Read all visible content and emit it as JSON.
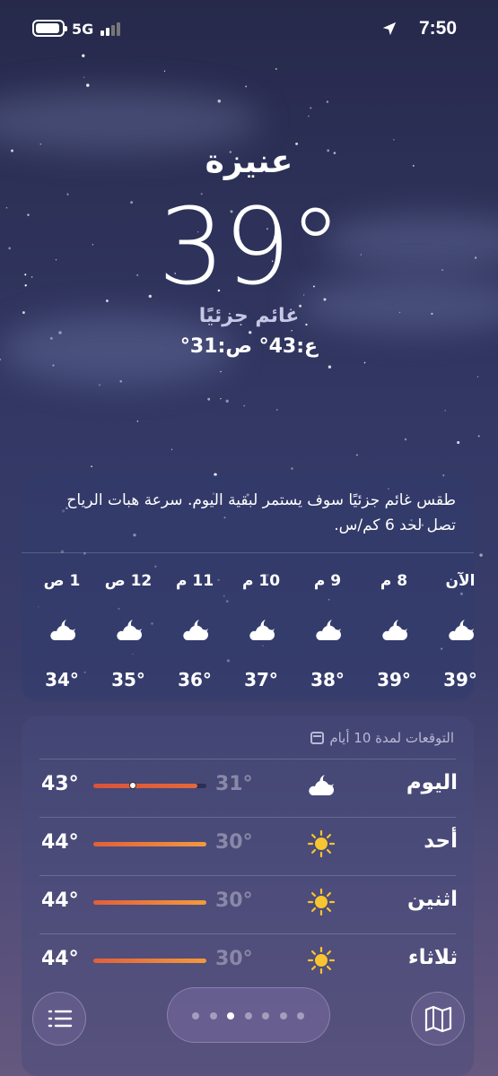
{
  "status_bar": {
    "network": "5G",
    "time": "7:50"
  },
  "location": {
    "city": "عنيزة",
    "temperature": "39°",
    "condition": "غائم جزئيًا",
    "high_low": "ع:43°  ص:31°"
  },
  "hourly": {
    "summary": "طقس غائم جزئيًا سوف يستمر لبقية اليوم. سرعة هبات الرياح تصل لحد 6 كم/س.",
    "hours": [
      {
        "label": "الآن",
        "temp": "39°",
        "icon": "partly-cloudy-night-icon"
      },
      {
        "label": "8 م",
        "temp": "39°",
        "icon": "partly-cloudy-night-icon"
      },
      {
        "label": "9 م",
        "temp": "38°",
        "icon": "partly-cloudy-night-icon"
      },
      {
        "label": "10 م",
        "temp": "37°",
        "icon": "partly-cloudy-night-icon"
      },
      {
        "label": "11 م",
        "temp": "36°",
        "icon": "partly-cloudy-night-icon"
      },
      {
        "label": "12 ص",
        "temp": "35°",
        "icon": "partly-cloudy-night-icon"
      },
      {
        "label": "1 ص",
        "temp": "34°",
        "icon": "partly-cloudy-night-icon"
      }
    ]
  },
  "daily": {
    "header": "التوقعات لمدة 10 أيام",
    "days": [
      {
        "day": "اليوم",
        "low": "31°",
        "high": "43°",
        "icon": "partly-cloudy-night-icon",
        "range_start": 0.0,
        "range_end": 0.92,
        "current": 0.35
      },
      {
        "day": "أحد",
        "low": "30°",
        "high": "44°",
        "icon": "sun-icon",
        "range_start": 0.0,
        "range_end": 1.0
      },
      {
        "day": "اثنين",
        "low": "30°",
        "high": "44°",
        "icon": "sun-icon",
        "range_start": 0.0,
        "range_end": 1.0
      },
      {
        "day": "ثلاثاء",
        "low": "30°",
        "high": "44°",
        "icon": "sun-icon",
        "range_start": 0.0,
        "range_end": 1.0
      }
    ]
  },
  "pager": {
    "count": 7,
    "active_index": 2
  },
  "colors": {
    "bar_warm": "#e0603a",
    "bar_hot": "#f39a3c",
    "sun": "#f7c531"
  }
}
